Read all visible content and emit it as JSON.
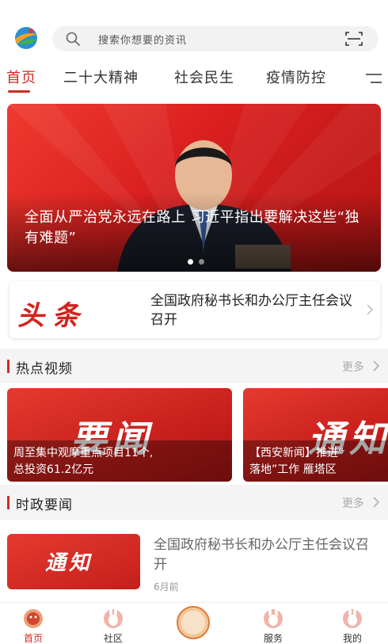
{
  "search": {
    "placeholder": "搜索你想要的资讯"
  },
  "tabs": [
    {
      "label": "首页",
      "active": true
    },
    {
      "label": "二十大精神",
      "active": false
    },
    {
      "label": "社会民生",
      "active": false
    },
    {
      "label": "疫情防控",
      "active": false
    }
  ],
  "hero": {
    "caption": "全面从严治党永远在路上 习近平指出要解决这些“独有难题”",
    "slide_count": 2,
    "active_slide": 1
  },
  "headline": {
    "badge": "头条",
    "title": "全国政府秘书长和办公厅主任会议召开"
  },
  "sections": {
    "hot_video": {
      "title": "热点视频",
      "more": "更多"
    },
    "politics": {
      "title": "时政要闻",
      "more": "更多"
    }
  },
  "videos": [
    {
      "art_text": "要闻",
      "caption_line1": "周至集中观摩重点项目11个,",
      "caption_line2": "总投资61.2亿元"
    },
    {
      "art_text": "通知",
      "caption_line1": "【西安新闻】推进“",
      "caption_line2": "落地”工作 雁塔区"
    }
  ],
  "news": [
    {
      "thumb_text": "通知",
      "title": "全国政府秘书长和办公厅主任会议召开",
      "time": "6月前"
    }
  ],
  "bottom_nav": [
    {
      "label": "首页",
      "active": true
    },
    {
      "label": "社区",
      "active": false
    },
    {
      "label": "",
      "active": false
    },
    {
      "label": "服务",
      "active": false
    },
    {
      "label": "我的",
      "active": false
    }
  ],
  "colors": {
    "accent": "#d22a22",
    "banner_red": "#d81e1e",
    "section_bg": "#f4f4f4"
  }
}
